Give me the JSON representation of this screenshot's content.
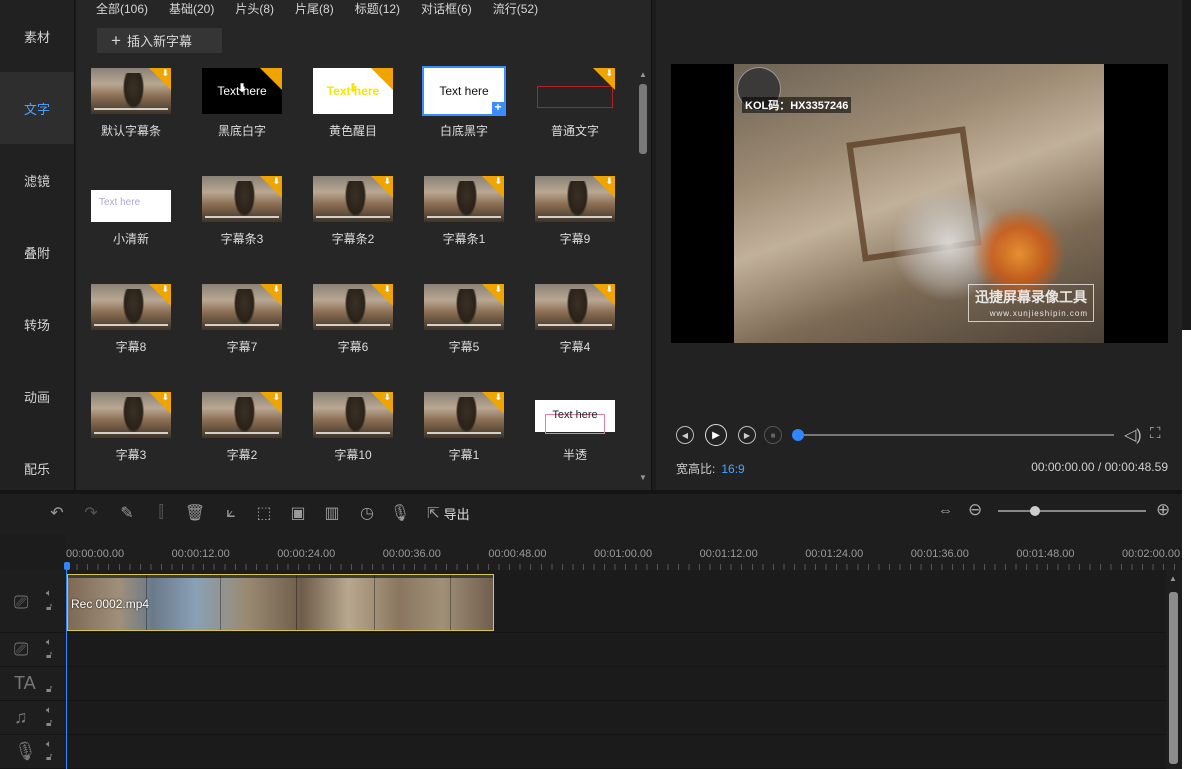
{
  "nav": {
    "items": [
      {
        "label": "素材",
        "active": false
      },
      {
        "label": "文字",
        "active": true
      },
      {
        "label": "滤镜",
        "active": false
      },
      {
        "label": "叠附",
        "active": false
      },
      {
        "label": "转场",
        "active": false
      },
      {
        "label": "动画",
        "active": false
      },
      {
        "label": "配乐",
        "active": false
      }
    ]
  },
  "library": {
    "tabs": [
      "全部(106)",
      "基础(20)",
      "片头(8)",
      "片尾(8)",
      "标题(12)",
      "对话框(6)",
      "流行(52)"
    ],
    "insert_label": "插入新字幕",
    "tiles": [
      {
        "label": "默认字幕条",
        "kind": "photo",
        "badge": true
      },
      {
        "label": "黑底白字",
        "kind": "black",
        "text": "Text here",
        "badge": true
      },
      {
        "label": "黄色醒目",
        "kind": "yellow",
        "text": "Text here",
        "badge": true
      },
      {
        "label": "白底黑字",
        "kind": "white",
        "text": "Text here",
        "badge": false,
        "selected": true
      },
      {
        "label": "普通文字",
        "kind": "plain",
        "badge": true
      },
      {
        "label": "小清新",
        "kind": "fresh",
        "text": "Text here",
        "badge": false
      },
      {
        "label": "字幕条3",
        "kind": "photo",
        "badge": true
      },
      {
        "label": "字幕条2",
        "kind": "photo",
        "badge": true
      },
      {
        "label": "字幕条1",
        "kind": "photo",
        "badge": true
      },
      {
        "label": "字幕9",
        "kind": "photo",
        "badge": true
      },
      {
        "label": "字幕8",
        "kind": "photo",
        "badge": true
      },
      {
        "label": "字幕7",
        "kind": "photo",
        "badge": true
      },
      {
        "label": "字幕6",
        "kind": "photo",
        "badge": true
      },
      {
        "label": "字幕5",
        "kind": "photo",
        "badge": true
      },
      {
        "label": "字幕4",
        "kind": "photo",
        "badge": true
      },
      {
        "label": "字幕3",
        "kind": "photo",
        "badge": true
      },
      {
        "label": "字幕2",
        "kind": "photo",
        "badge": true
      },
      {
        "label": "字幕10",
        "kind": "photo",
        "badge": true
      },
      {
        "label": "字幕1",
        "kind": "photo",
        "badge": true
      },
      {
        "label": "半透",
        "kind": "semi",
        "text": "Text here",
        "badge": false
      }
    ]
  },
  "preview": {
    "kol_text": "KOL码：HX3357246",
    "watermark_cn": "迅捷屏幕录像工具",
    "watermark_url": "www.xunjieshipin.com",
    "aspect_label": "宽高比:",
    "aspect_value": "16:9",
    "timecode": "00:00:00.00 / 00:00:48.59",
    "progress": 0
  },
  "toolbar": {
    "export_label": "导出",
    "zoom_level": 0.25
  },
  "ruler": {
    "labels": [
      "00:00:00.00",
      "00:00:12.00",
      "00:00:24.00",
      "00:00:36.00",
      "00:00:48.00",
      "00:01:00.00",
      "00:01:12.00",
      "00:01:24.00",
      "00:01:36.00",
      "00:01:48.00",
      "00:02:00.00"
    ]
  },
  "timeline": {
    "clip_name": "Rec 0002.mp4"
  },
  "icons": {
    "badge": "download-icon",
    "add": "plus-icon"
  },
  "colors": {
    "accent": "#2f87ff",
    "badge": "#f0a400",
    "active_nav": "#4ea3ff"
  }
}
